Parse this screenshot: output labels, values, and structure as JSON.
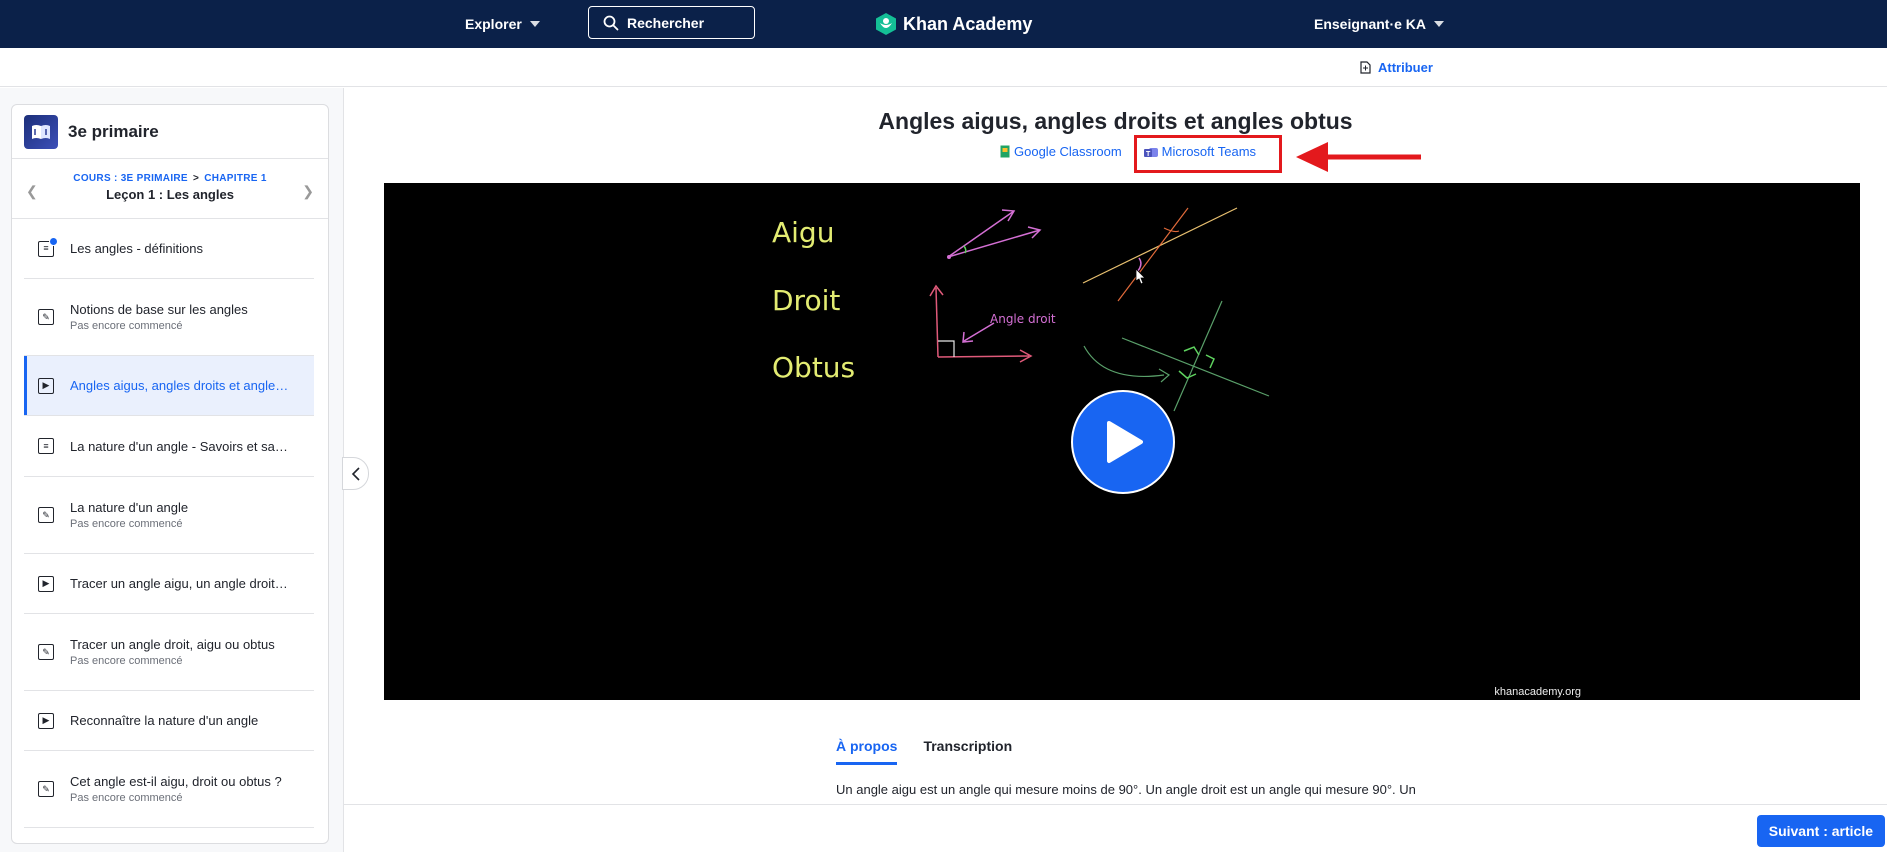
{
  "topnav": {
    "explore_label": "Explorer",
    "search_label": "Rechercher",
    "logo_text": "Khan Academy",
    "user_label": "Enseignant·e KA"
  },
  "subbar": {
    "assign_label": "Attribuer"
  },
  "sidebar": {
    "course_title": "3e primaire",
    "breadcrumb_course": "COURS : 3E PRIMAIRE",
    "breadcrumb_sep": ">",
    "breadcrumb_chapter": "CHAPITRE 1",
    "lesson_title": "Leçon 1 : Les angles",
    "items": [
      {
        "title": "Les angles - définitions",
        "sub": "",
        "icon": "article-icon"
      },
      {
        "title": "Notions de base sur les angles",
        "sub": "Pas encore commencé",
        "icon": "exercise-icon"
      },
      {
        "title": "Angles aigus, angles droits et angles obtus",
        "sub": "",
        "icon": "video-icon"
      },
      {
        "title": "La nature d'un angle - Savoirs et savoir-faire",
        "sub": "",
        "icon": "article-icon"
      },
      {
        "title": "La nature d'un angle",
        "sub": "Pas encore commencé",
        "icon": "exercise-icon"
      },
      {
        "title": "Tracer un angle aigu, un angle droit ou un angle obtus",
        "sub": "",
        "icon": "video-icon"
      },
      {
        "title": "Tracer un angle droit, aigu ou obtus",
        "sub": "Pas encore commencé",
        "icon": "exercise-icon"
      },
      {
        "title": "Reconnaître la nature d'un angle",
        "sub": "",
        "icon": "video-icon"
      },
      {
        "title": "Cet angle est-il aigu, droit ou obtus ?",
        "sub": "Pas encore commencé",
        "icon": "exercise-icon"
      }
    ]
  },
  "main": {
    "title": "Angles aigus, angles droits et angles obtus",
    "share_google": "Google Classroom",
    "share_teams": "Microsoft Teams",
    "video": {
      "label_acute": "Aigu",
      "label_right": "Droit",
      "label_obtuse": "Obtus",
      "annotation": "Angle droit",
      "watermark": "khanacademy.org"
    },
    "tabs": [
      "À propos",
      "Transcription"
    ],
    "description": "Un angle aigu est un angle qui mesure moins de 90°.  Un angle droit est un angle qui mesure 90°.  Un"
  },
  "footer": {
    "next_label": "Suivant : article"
  },
  "colors": {
    "nav_bg": "#0b2149",
    "accent": "#1865f2",
    "highlight_red": "#e3191d"
  }
}
